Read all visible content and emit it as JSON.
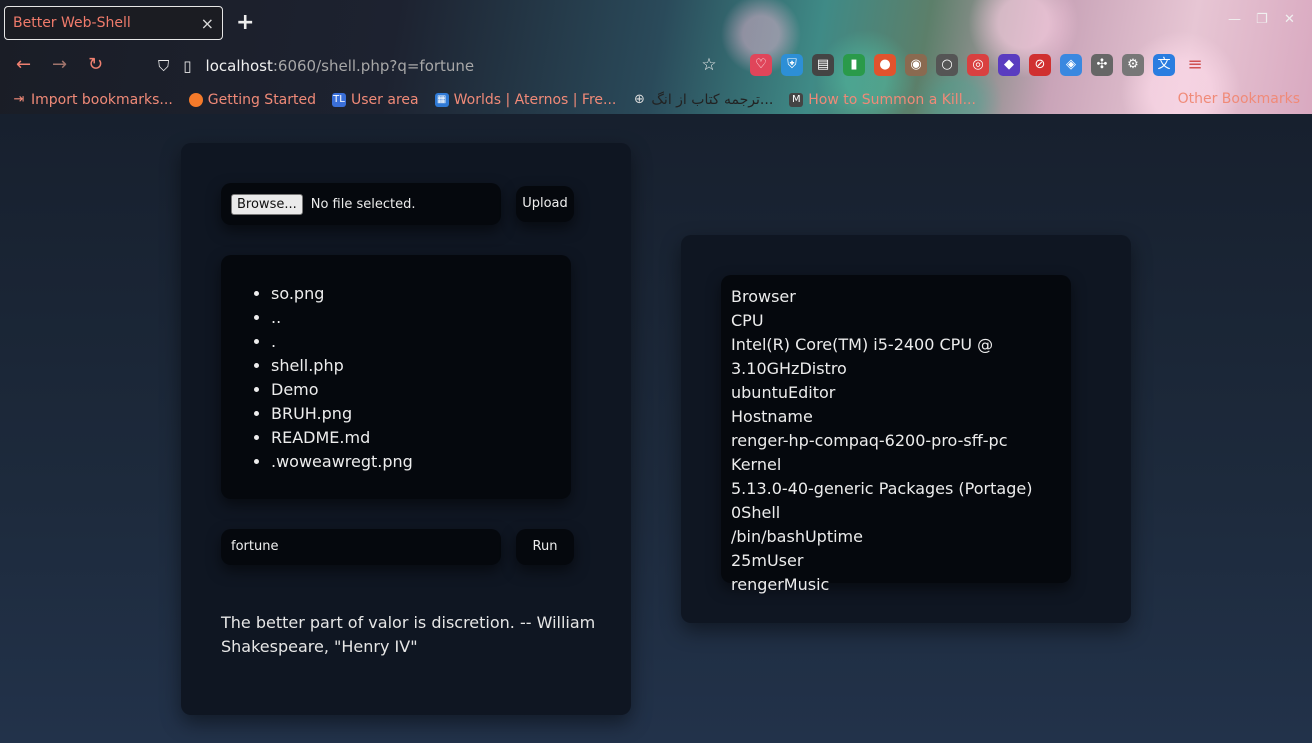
{
  "browser": {
    "tab_title": "Better Web-Shell",
    "tab_close": "×",
    "new_tab": "+",
    "url_host": "localhost",
    "url_rest": ":6060/shell.php?q=fortune",
    "bookmarks": [
      {
        "label": "Import bookmarks...",
        "icon": "import-icon",
        "color": "#f08a78"
      },
      {
        "label": "Getting Started",
        "icon": "firefox-icon",
        "color": "#f47a2a"
      },
      {
        "label": "User area",
        "icon": "tl-icon",
        "color": "#3a6fd8"
      },
      {
        "label": "Worlds | Aternos | Fre...",
        "icon": "aternos-icon",
        "color": "#2f7ad6"
      },
      {
        "label": "ترجمه کتاب از انگ...",
        "icon": "globe-icon",
        "color": "#888888"
      },
      {
        "label": "How to Summon a Kill...",
        "icon": "m-icon",
        "color": "#444444"
      }
    ],
    "other_bookmarks": "Other Bookmarks"
  },
  "uploader": {
    "browse_label": "Browse...",
    "file_status": "No file selected.",
    "upload_label": "Upload"
  },
  "files": [
    "so.png",
    "..",
    ".",
    "shell.php",
    "Demo",
    "BRUH.png",
    "README.md",
    ".woweawregt.png"
  ],
  "command": {
    "value": "fortune",
    "run_label": "Run"
  },
  "output": "The better part of valor is discretion. -- William Shakespeare, \"Henry IV\"",
  "sysinfo": [
    "Browser",
    "CPU",
    "Intel(R) Core(TM) i5-2400 CPU @",
    "3.10GHzDistro",
    "ubuntuEditor",
    "Hostname",
    "renger-hp-compaq-6200-pro-sff-pc Kernel",
    "5.13.0-40-generic Packages (Portage)",
    "0Shell",
    "/bin/bashUptime",
    "25mUser",
    "rengerMusic"
  ]
}
